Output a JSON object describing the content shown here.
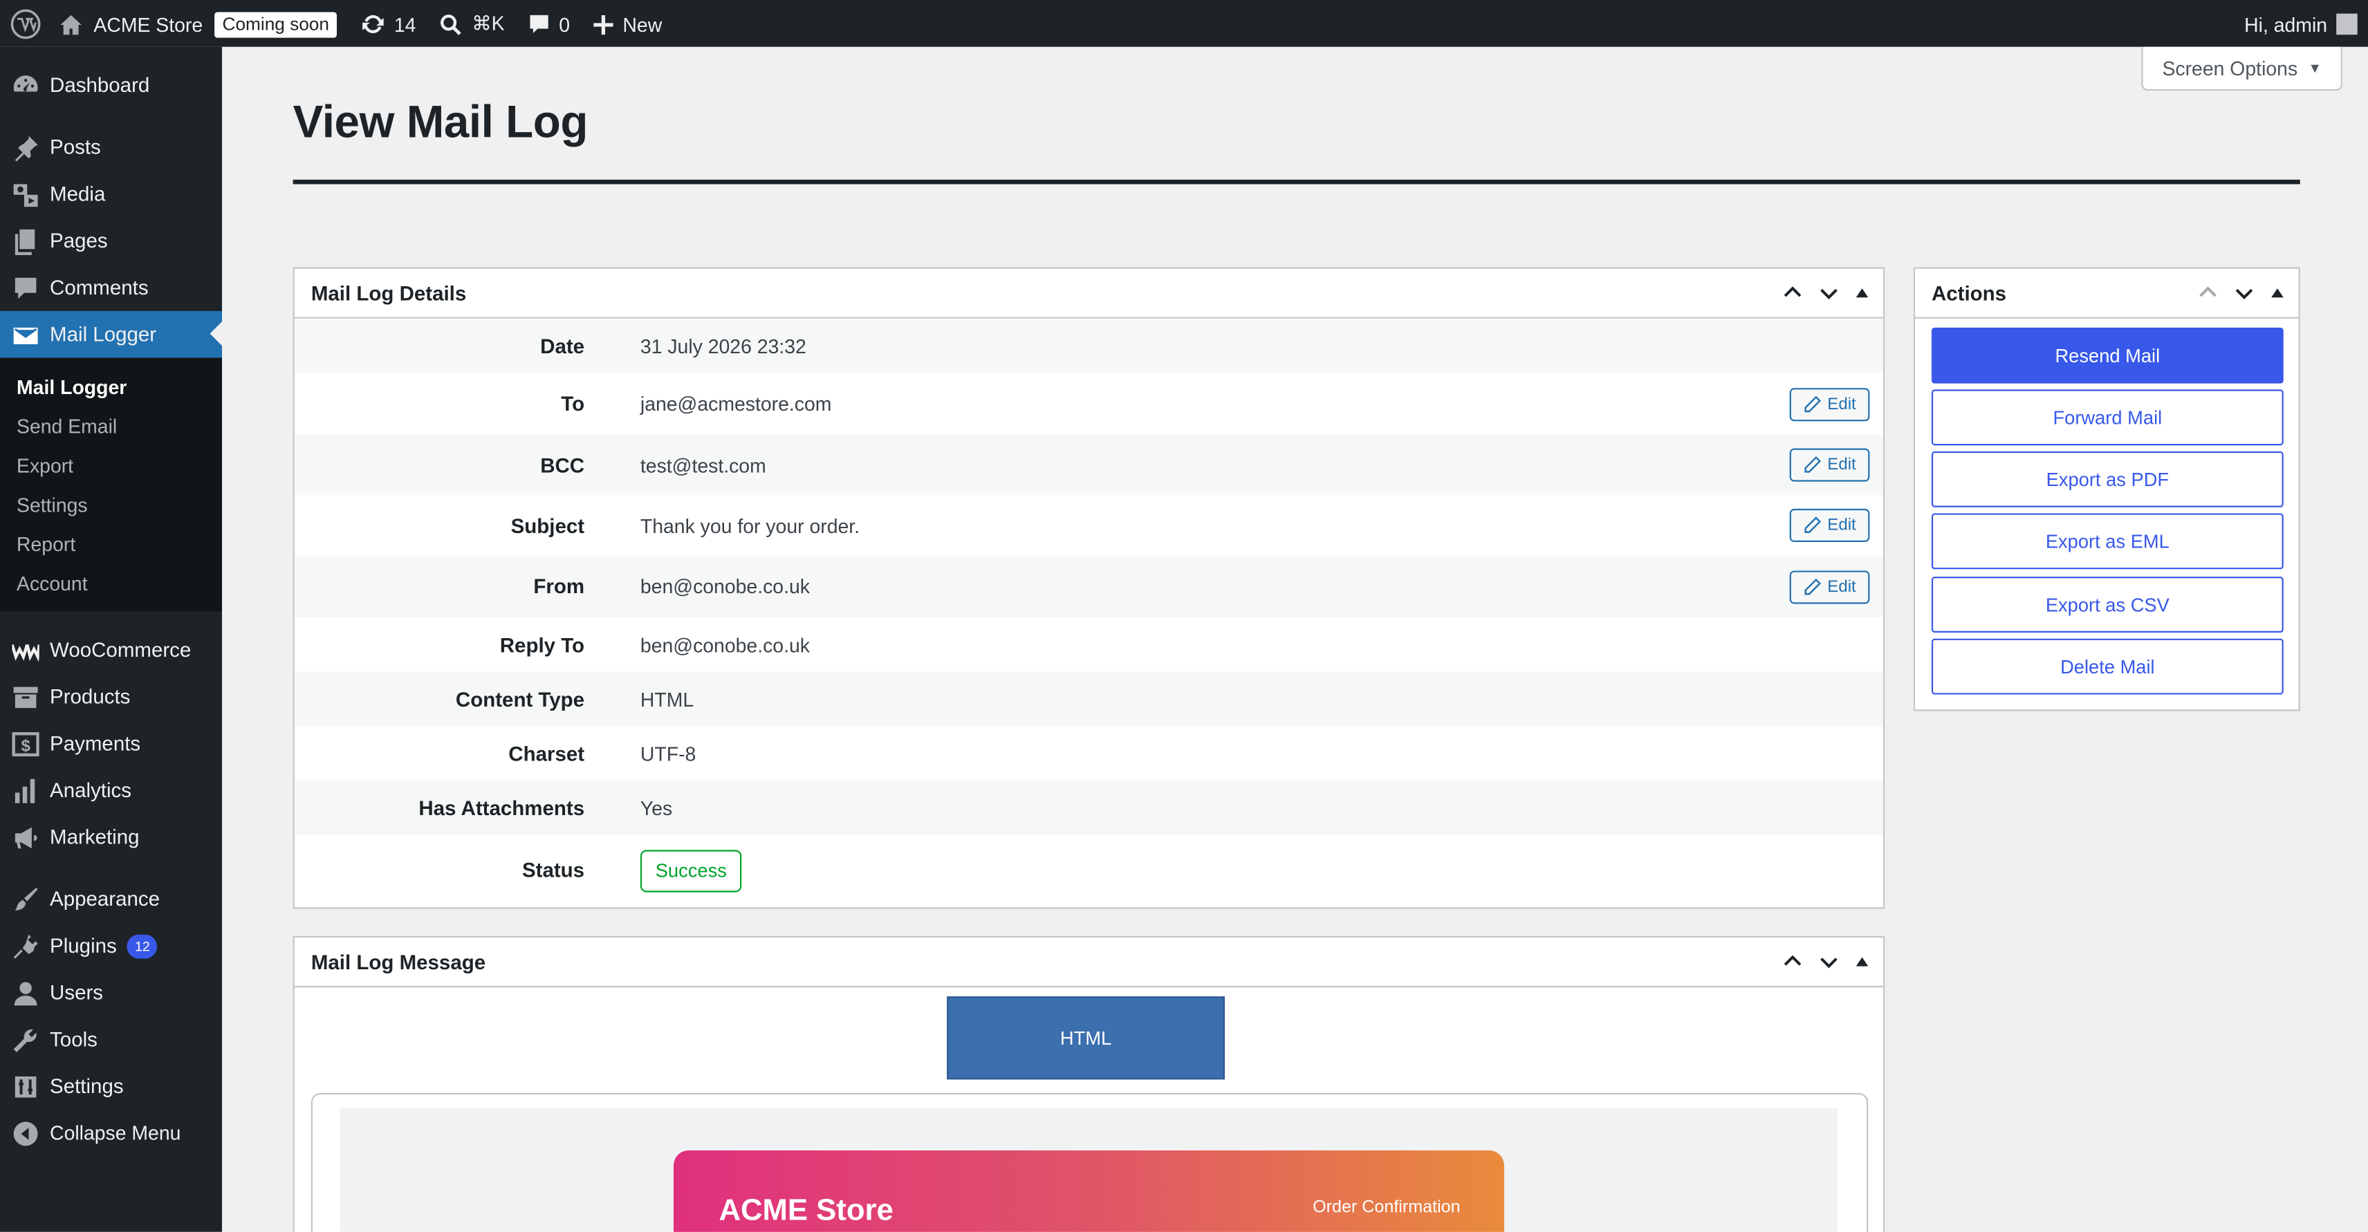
{
  "admin_bar": {
    "site_name": "ACME Store",
    "status_badge": "Coming soon",
    "updates_count": "14",
    "search_shortcut": "⌘K",
    "comments_count": "0",
    "new_label": "New",
    "greeting": "Hi, admin"
  },
  "sidebar": {
    "dashboard": "Dashboard",
    "posts": "Posts",
    "media": "Media",
    "pages": "Pages",
    "comments": "Comments",
    "mail_logger": "Mail Logger",
    "submenu": [
      "Mail Logger",
      "Send Email",
      "Export",
      "Settings",
      "Report",
      "Account"
    ],
    "woocommerce": "WooCommerce",
    "products": "Products",
    "payments": "Payments",
    "analytics": "Analytics",
    "marketing": "Marketing",
    "appearance": "Appearance",
    "plugins": "Plugins",
    "plugins_badge": "12",
    "users": "Users",
    "tools": "Tools",
    "settings": "Settings",
    "collapse": "Collapse Menu"
  },
  "screen_options": "Screen Options",
  "page_title": "View Mail Log",
  "details": {
    "title": "Mail Log Details",
    "edit_label": "Edit",
    "rows": [
      {
        "label": "Date",
        "value": "31 July 2026 23:32"
      },
      {
        "label": "To",
        "value": "jane@acmestore.com"
      },
      {
        "label": "BCC",
        "value": "test@test.com"
      },
      {
        "label": "Subject",
        "value": "Thank you for your order."
      },
      {
        "label": "From",
        "value": "ben@conobe.co.uk"
      },
      {
        "label": "Reply To",
        "value": "ben@conobe.co.uk"
      },
      {
        "label": "Content Type",
        "value": "HTML"
      },
      {
        "label": "Charset",
        "value": "UTF-8"
      },
      {
        "label": "Has Attachments",
        "value": "Yes"
      },
      {
        "label": "Status",
        "value": "Success"
      }
    ]
  },
  "actions": {
    "title": "Actions",
    "buttons": [
      "Resend Mail",
      "Forward Mail",
      "Export as PDF",
      "Export as EML",
      "Export as CSV",
      "Delete Mail"
    ]
  },
  "message": {
    "title": "Mail Log Message",
    "tab_label": "HTML",
    "email_brand": "ACME Store",
    "email_subtitle": "Order Confirmation"
  },
  "colors": {
    "admin_dark": "#1d2327",
    "wp_blue": "#2271b1",
    "button_blue": "#3858e9",
    "success_green": "#00a32a",
    "html_tab": "#3b6fad"
  }
}
